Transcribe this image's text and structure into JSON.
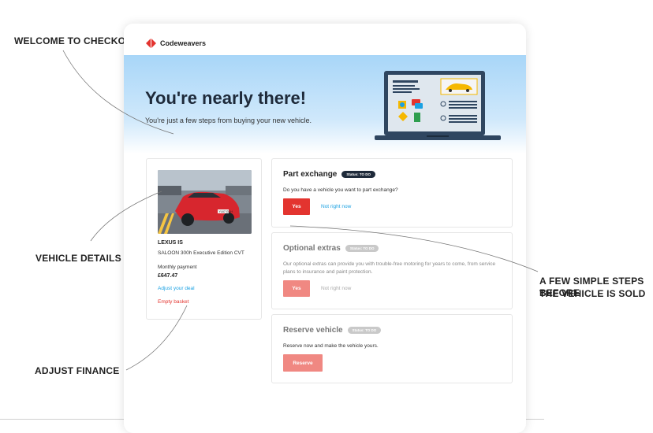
{
  "annotations": {
    "welcome": "WELCOME TO CHECKOUT",
    "vehicle": "VEHICLE DETAILS",
    "finance": "ADJUST FINANCE",
    "steps_line1": "A FEW SIMPLE STEPS BEFORE",
    "steps_line2": "THE VEHICLE IS SOLD"
  },
  "brand": {
    "name": "Codeweavers",
    "accent": "#e3342f"
  },
  "hero": {
    "title": "You're nearly there!",
    "subtitle": "You're just a few steps from buying your new vehicle."
  },
  "vehicle": {
    "name": "LEXUS IS",
    "trim": "SALOON 300h Executive Edition CVT",
    "monthly_label": "Monthly payment",
    "monthly_price": "£647.47",
    "adjust_link": "Adjust your deal",
    "empty_link": "Empty basket",
    "photo_plate": "YL67 GUH"
  },
  "steps": [
    {
      "title": "Part exchange",
      "status": "Status: TO DO",
      "text": "Do you have a vehicle you want to part exchange?",
      "primary": "Yes",
      "secondary": "Not right now"
    },
    {
      "title": "Optional extras",
      "status": "Status: TO DO",
      "text": "Our optional extras can provide you with trouble-free motoring for years to come, from service plans to insurance and paint protection.",
      "primary": "Yes",
      "secondary": "Not right now"
    },
    {
      "title": "Reserve vehicle",
      "status": "Status: TO DO",
      "text": "Reserve now and make the vehicle yours.",
      "primary": "Reserve"
    }
  ],
  "colors": {
    "link_blue": "#1ba1e2",
    "navy": "#1e2a3a",
    "hero_blue": "#a8d6f8"
  }
}
